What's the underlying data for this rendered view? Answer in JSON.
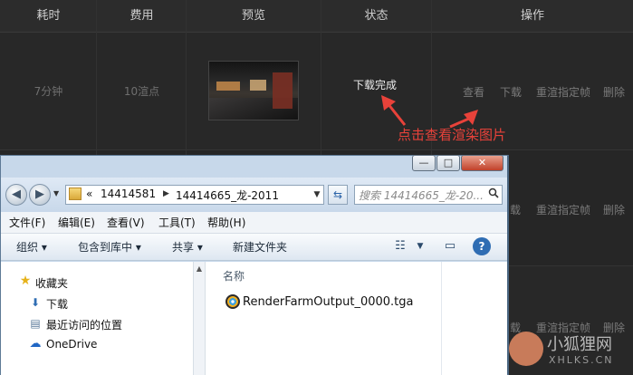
{
  "table": {
    "headers": [
      "耗时",
      "费用",
      "预览",
      "状态",
      "操作"
    ],
    "row": {
      "duration": "7分钟",
      "cost": "10渲点",
      "status": "下载完成",
      "actions": [
        "查看",
        "下载",
        "重渲指定帧",
        "删除"
      ]
    },
    "partial_actions": {
      "row2": [
        "载",
        "重渲指定帧",
        "删除"
      ],
      "row3": [
        "载",
        "重渲指定帧",
        "删除"
      ]
    }
  },
  "annotation": {
    "text": "点击查看渲染图片",
    "color": "#e8423a"
  },
  "explorer": {
    "window_buttons": [
      "—",
      "□",
      "✕"
    ],
    "address": {
      "prefix": "«",
      "segments": [
        "14414581",
        "14414665_龙-2011"
      ]
    },
    "search_placeholder": "搜索 14414665_龙-20...",
    "menu": [
      "文件(F)",
      "编辑(E)",
      "查看(V)",
      "工具(T)",
      "帮助(H)"
    ],
    "toolbar": [
      "组织 ▾",
      "包含到库中 ▾",
      "共享 ▾",
      "新建文件夹"
    ],
    "nav_items": [
      "收藏夹",
      "下载",
      "最近访问的位置",
      "OneDrive"
    ],
    "column_header": "名称",
    "files": [
      "RenderFarmOutput_0000.tga"
    ]
  },
  "watermark": {
    "text": "小狐狸网",
    "subtext": "XHLKS.CN"
  },
  "colors": {
    "accent_red": "#e8423a",
    "table_bg": "#262626",
    "explorer_frame": "#c7d8ea"
  }
}
